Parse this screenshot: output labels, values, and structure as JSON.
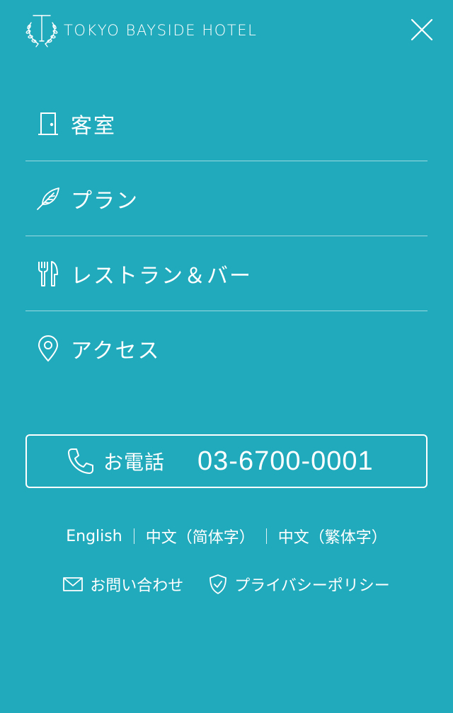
{
  "header": {
    "logo_text": "TOKYO BAYSIDE HOTEL",
    "logo_icon": "laurel-t-logo-icon",
    "close_icon": "close-icon"
  },
  "nav": {
    "items": [
      {
        "label": "客室",
        "icon": "door-icon"
      },
      {
        "label": "プラン",
        "icon": "feather-icon"
      },
      {
        "label": "レストラン＆バー",
        "icon": "fork-knife-icon"
      },
      {
        "label": "アクセス",
        "icon": "map-pin-icon"
      }
    ]
  },
  "phone": {
    "label": "お電話",
    "number": "03-6700-0001",
    "icon": "phone-icon"
  },
  "languages": [
    "English",
    "中文（简体字）",
    "中文（繁体字）"
  ],
  "footer_links": {
    "contact": {
      "label": "お問い合わせ",
      "icon": "mail-icon"
    },
    "privacy": {
      "label": "プライバシーポリシー",
      "icon": "shield-check-icon"
    }
  },
  "colors": {
    "background": "#21aabb",
    "foreground": "#ffffff"
  }
}
